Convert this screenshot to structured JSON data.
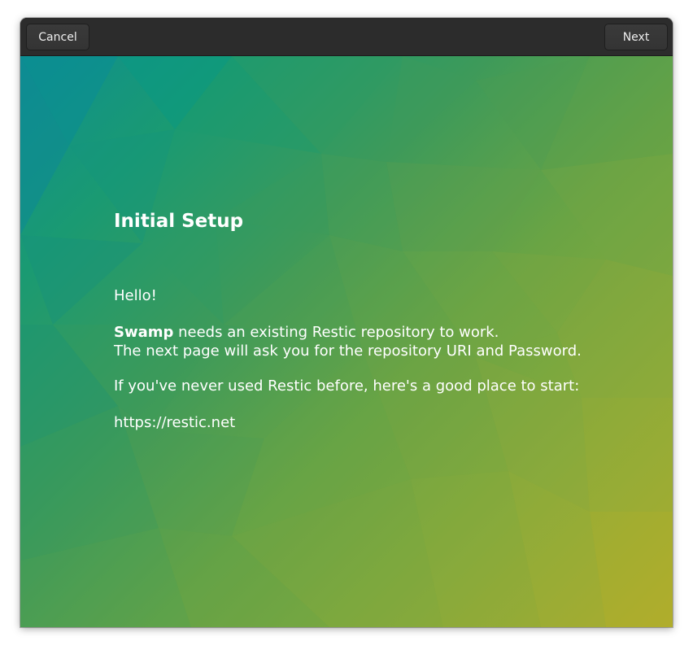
{
  "headerbar": {
    "cancel_label": "Cancel",
    "next_label": "Next"
  },
  "page": {
    "title": "Initial Setup",
    "greeting": "Hello!",
    "app_name": "Swamp",
    "intro_rest": " needs an existing Restic repository to work.",
    "intro_line2": "The next page will ask you for the repository URI and Password.",
    "restic_hint": "If you've never used Restic before, here's a good place to start:",
    "link": "https://restic.net"
  },
  "colors": {
    "headerbar_bg": "#2c2c2c",
    "text": "#ffffff",
    "gradient_start": "#0e8f8f",
    "gradient_end": "#b0ad2c"
  }
}
